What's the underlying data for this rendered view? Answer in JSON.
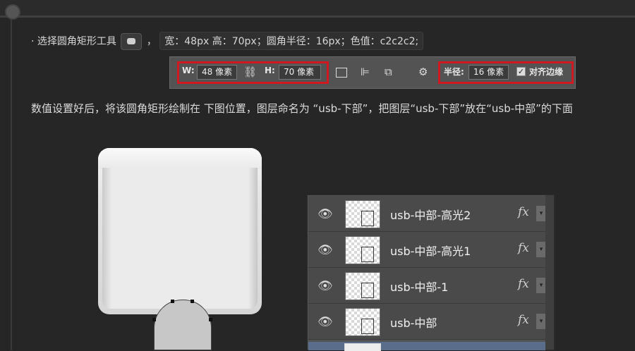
{
  "instruction": {
    "bullet": "· 选择圆角矩形工具",
    "comma": "，",
    "specs": "宽：48px 高：70px；圆角半径：16px；色值：c2c2c2;"
  },
  "toolbar": {
    "w_label": "W:",
    "w_value": "48 像素",
    "h_label": "H:",
    "h_value": "70 像素",
    "radius_label": "半径:",
    "radius_value": "16 像素",
    "align_label": "对齐边缘",
    "checkbox": "✓"
  },
  "paragraph": "数值设置好后，将该圆角矩形绘制在 下图位置，图层命名为 “usb-下部”，把图层“usb-下部”放在“usb-中部”的下面",
  "layers": [
    {
      "name": "usb-中部-高光2",
      "fx": "fx"
    },
    {
      "name": "usb-中部-高光1",
      "fx": "fx"
    },
    {
      "name": "usb-中部-1",
      "fx": "fx"
    },
    {
      "name": "usb-中部",
      "fx": "fx"
    }
  ],
  "icons": {
    "eye": "👁",
    "link": "⛓",
    "gear": "⚙",
    "chevron": "▾"
  }
}
